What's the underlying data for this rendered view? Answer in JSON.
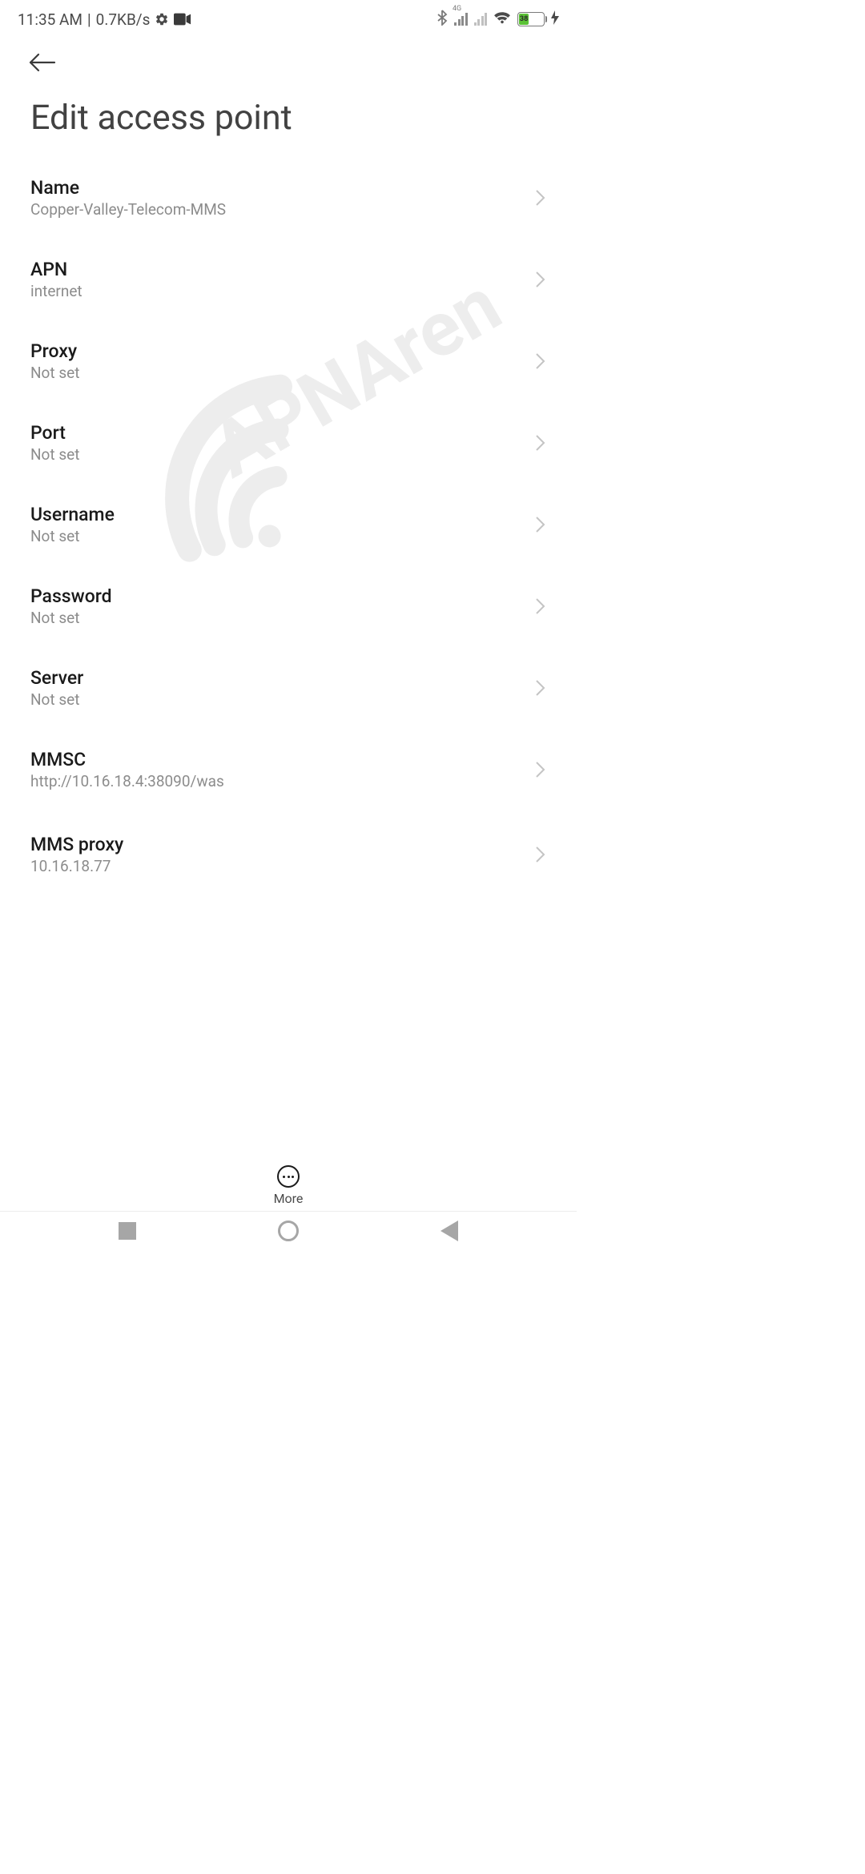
{
  "status": {
    "time": "11:35 AM",
    "separator": "|",
    "data_rate": "0.7KB/s",
    "battery_level": "38",
    "network_gen": "4G"
  },
  "header": {
    "title": "Edit access point"
  },
  "settings": [
    {
      "label": "Name",
      "value": "Copper-Valley-Telecom-MMS"
    },
    {
      "label": "APN",
      "value": "internet"
    },
    {
      "label": "Proxy",
      "value": "Not set"
    },
    {
      "label": "Port",
      "value": "Not set"
    },
    {
      "label": "Username",
      "value": "Not set"
    },
    {
      "label": "Password",
      "value": "Not set"
    },
    {
      "label": "Server",
      "value": "Not set"
    },
    {
      "label": "MMSC",
      "value": "http://10.16.18.4:38090/was"
    },
    {
      "label": "MMS proxy",
      "value": "10.16.18.77"
    }
  ],
  "bottom_action": {
    "label": "More"
  },
  "watermark": "APNArena"
}
